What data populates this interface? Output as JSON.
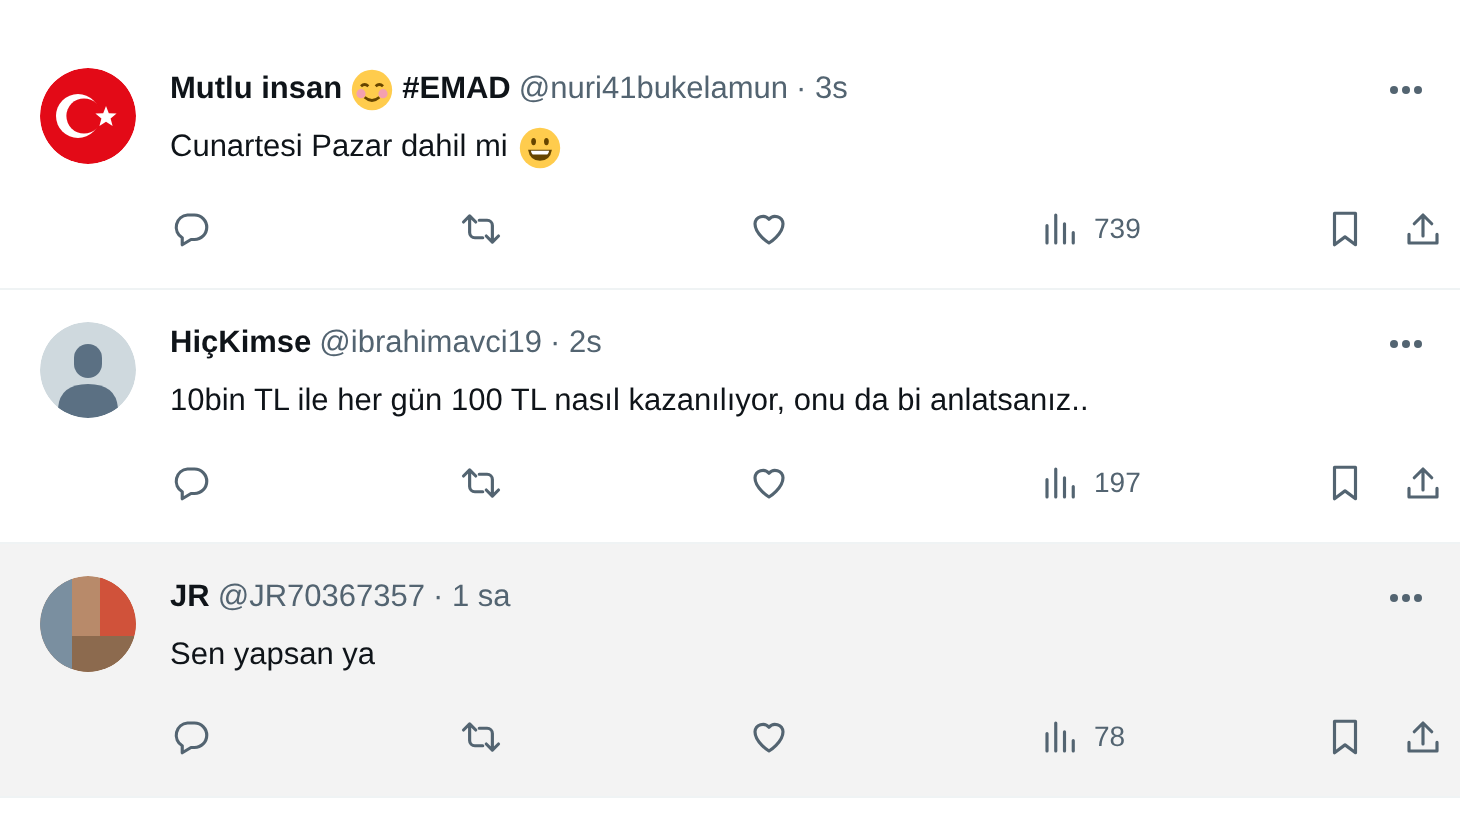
{
  "tweets": [
    {
      "avatar": {
        "kind": "flag"
      },
      "highlighted": false,
      "name": [
        {
          "kind": "text",
          "text": "Mutlu insan"
        },
        {
          "kind": "emoji-blush"
        },
        {
          "kind": "text",
          "text": "#EMAD"
        }
      ],
      "handle": "@nuri41bukelamun",
      "time": "· 3s",
      "body": [
        {
          "kind": "text",
          "text": "Cunartesi Pazar dahil mi"
        },
        {
          "kind": "emoji-grin"
        }
      ],
      "views": "739"
    },
    {
      "avatar": {
        "kind": "default"
      },
      "highlighted": false,
      "name": [
        {
          "kind": "text",
          "text": "HiçKimse"
        }
      ],
      "handle": "@ibrahimavci19",
      "time": "· 2s",
      "body": [
        {
          "kind": "text",
          "text": "10bin TL ile her gün 100 TL nasıl kazanılıyor, onu da bi anlatsanız.."
        }
      ],
      "views": "197"
    },
    {
      "avatar": {
        "kind": "photo"
      },
      "highlighted": true,
      "name": [
        {
          "kind": "text",
          "text": "JR"
        }
      ],
      "handle": "@JR70367357",
      "time": "· 1 sa",
      "body": [
        {
          "kind": "text",
          "text": "Sen yapsan ya"
        }
      ],
      "views": "78"
    }
  ]
}
